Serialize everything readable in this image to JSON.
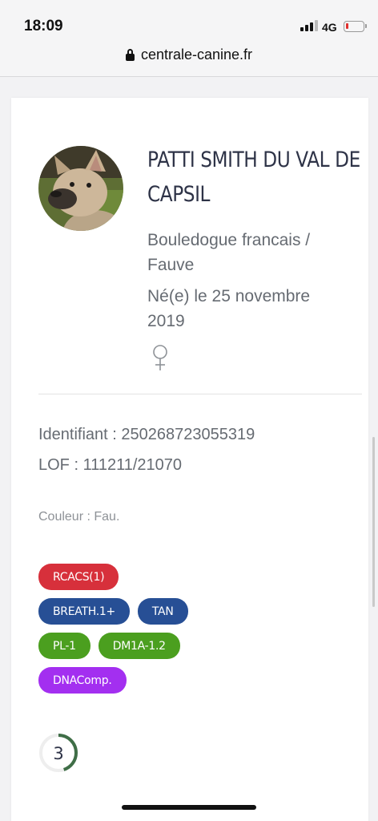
{
  "status_bar": {
    "time": "18:09",
    "network": "4G",
    "battery_color": "#e0302e"
  },
  "browser": {
    "url": "centrale-canine.fr",
    "lock_icon": "lock-icon"
  },
  "dog": {
    "name": "PATTI SMITH DU VAL DE CAPSIL",
    "breed": "Bouledogue francais / Fauve",
    "birth": "Né(e) le 25 novembre 2019",
    "sex_icon": "female-icon",
    "identifiant": "Identifiant : 250268723055319",
    "lof": "LOF : 111211/21070",
    "couleur": "Couleur : Fau."
  },
  "tags": [
    {
      "label": "RCACS(1)",
      "color": "#d7303b"
    },
    {
      "label": "BREATH.1+",
      "color": "#274f95"
    },
    {
      "label": "TAN",
      "color": "#274f95"
    },
    {
      "label": "PL-1",
      "color": "#4b9f1f"
    },
    {
      "label": "DM1A-1.2",
      "color": "#4b9f1f"
    },
    {
      "label": "DNAComp.",
      "color": "#a32ff0"
    }
  ],
  "score": {
    "value": "3",
    "color": "#3f6e47",
    "fraction": 0.45
  }
}
